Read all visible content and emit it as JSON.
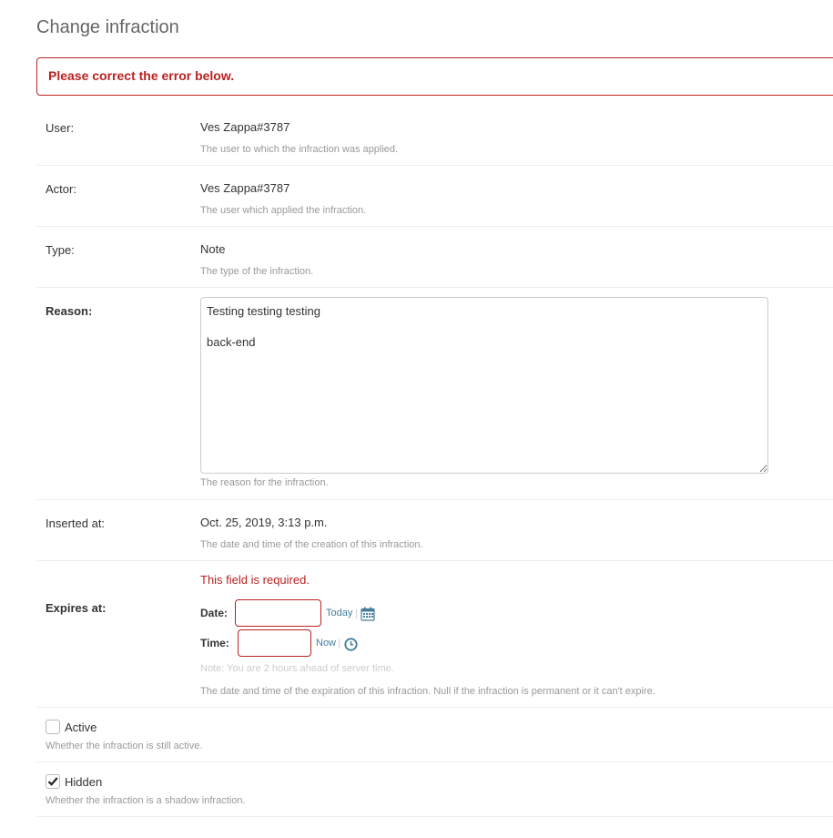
{
  "page": {
    "title": "Change infraction"
  },
  "errornote": "Please correct the error below.",
  "fields": {
    "user": {
      "label": "User:",
      "value": "Ves Zappa#3787",
      "help": "The user to which the infraction was applied."
    },
    "actor": {
      "label": "Actor:",
      "value": "Ves Zappa#3787",
      "help": "The user which applied the infraction."
    },
    "type": {
      "label": "Type:",
      "value": "Note",
      "help": "The type of the infraction."
    },
    "reason": {
      "label": "Reason:",
      "value": "Testing testing testing\n\nback-end",
      "help": "The reason for the infraction."
    },
    "inserted_at": {
      "label": "Inserted at:",
      "value": "Oct. 25, 2019, 3:13 p.m.",
      "help": "The date and time of the creation of this infraction."
    },
    "expires_at": {
      "label": "Expires at:",
      "error": "This field is required.",
      "date_label": "Date:",
      "date_value": "",
      "today_link": "Today",
      "calendar_icon": "calendar-icon",
      "time_label": "Time:",
      "time_value": "",
      "now_link": "Now",
      "clock_icon": "clock-icon",
      "separator": "|",
      "timezone_note": "Note: You are 2 hours ahead of server time.",
      "help": "The date and time of the expiration of this infraction. Null if the infraction is permanent or it can't expire."
    },
    "active": {
      "label": "Active",
      "checked": false,
      "help": "Whether the infraction is still active."
    },
    "hidden": {
      "label": "Hidden",
      "checked": true,
      "help": "Whether the infraction is a shadow infraction."
    }
  },
  "colors": {
    "error": "#ba2121",
    "link": "#447e9b",
    "help": "#999999",
    "border": "#eeeeee"
  }
}
